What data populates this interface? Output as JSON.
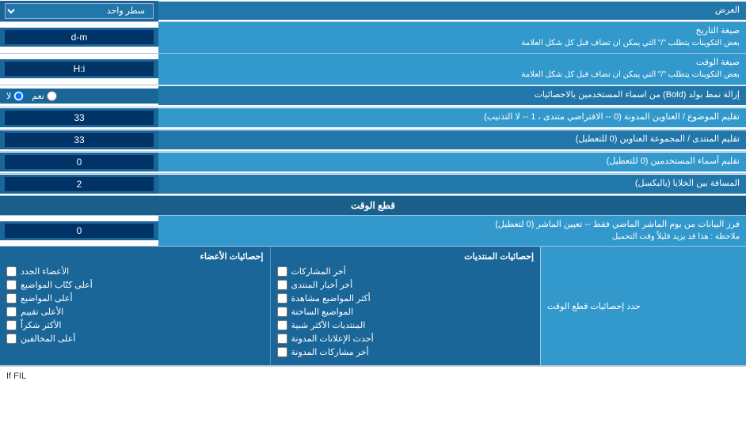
{
  "rows": [
    {
      "id": "row-alard",
      "label": "العرض",
      "input_type": "select",
      "input_value": "سطر واحد"
    },
    {
      "id": "row-date-format",
      "label": "صيغة التاريخ\nبعض التكوينات يتطلب \"/\" التي يمكن ان تضاف قبل كل شكل العلامة",
      "input_type": "text",
      "input_value": "d-m"
    },
    {
      "id": "row-time-format",
      "label": "صيغة الوقت\nبعض التكوينات يتطلب \"/\" التي يمكن ان تضاف قبل كل شكل العلامة",
      "input_type": "text",
      "input_value": "H:i"
    },
    {
      "id": "row-bold",
      "label": "إزالة نمط بولد (Bold) من اسماء المستخدمين بالاحصائيات",
      "input_type": "radio",
      "radio_options": [
        "نعم",
        "لا"
      ],
      "radio_selected": "لا"
    },
    {
      "id": "row-topics",
      "label": "تقليم الموضوع / العناوين المدونة (0 -- الافتراضي متندى ، 1 -- لا التذنيب)",
      "input_type": "text",
      "input_value": "33"
    },
    {
      "id": "row-forum",
      "label": "تقليم المنتدى / المجموعة العناوين (0 للتعطيل)",
      "input_type": "text",
      "input_value": "33"
    },
    {
      "id": "row-usernames",
      "label": "تقليم أسماء المستخدمين (0 للتعطيل)",
      "input_type": "text",
      "input_value": "0"
    },
    {
      "id": "row-distance",
      "label": "المسافة بين الخلايا (بالبكسل)",
      "input_type": "text",
      "input_value": "2"
    }
  ],
  "section_header": "قطع الوقت",
  "time_row": {
    "label": "فرز البيانات من يوم الماشر الماضي فقط -- تعيين الماشر (0 لتعطيل)\nملاحظة : هذا قد يزيد قليلاً وقت التحميل",
    "input_value": "0"
  },
  "checkboxes": {
    "header_label": "حدد إحصائيات قطع الوقت",
    "col1_title": "إحصائيات الأعضاء",
    "col2_title": "إحصائيات المنتديات",
    "col1_items": [
      "الأعضاء الجدد",
      "أعلى كتّاب المواضيع",
      "أعلى المواضيع",
      "الأعلى تقييم",
      "الأكثر شكراً",
      "أعلى المخالفين"
    ],
    "col2_items": [
      "أخر المشاركات",
      "أخر أخبار المنتدى",
      "أكثر المواضيع مشاهدة",
      "المواضيع الساخنة",
      "المنتديات الأكثر شبية",
      "أحدث الإعلانات المدونة",
      "أخر مشاركات المدونة"
    ],
    "col1_checked": [
      false,
      false,
      false,
      false,
      false,
      false
    ],
    "col2_checked": [
      false,
      false,
      false,
      false,
      false,
      false,
      false
    ]
  },
  "select_option": "سطر واحد",
  "bottom_text": "If FIL"
}
